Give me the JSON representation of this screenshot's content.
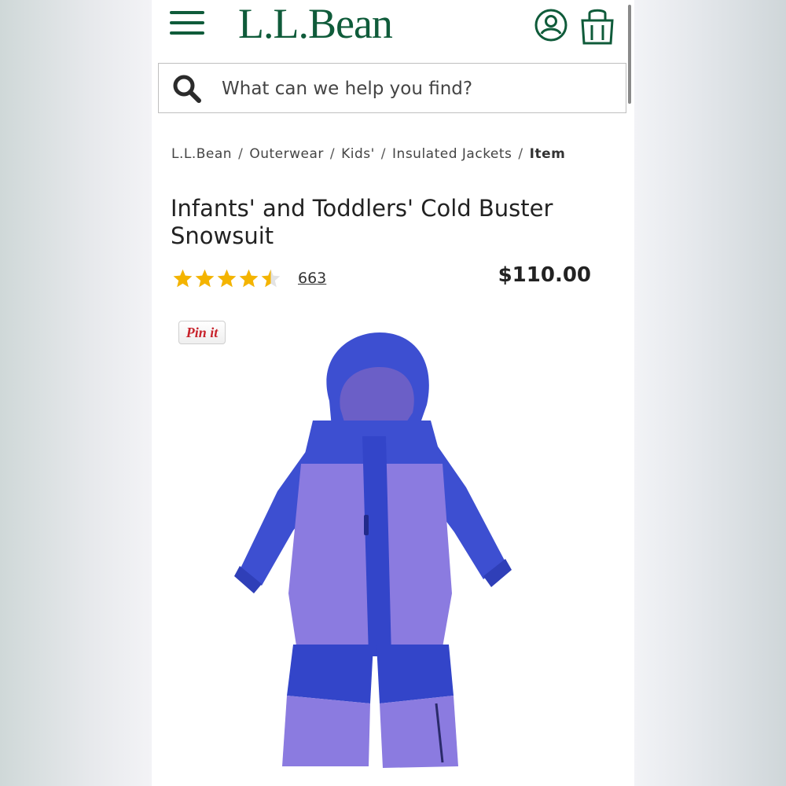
{
  "header": {
    "logo_text": "L.L.Bean",
    "menu_icon": "hamburger-menu-icon",
    "account_icon": "user-account-icon",
    "bag_icon": "shopping-bag-icon"
  },
  "search": {
    "placeholder": "What can we help you find?",
    "icon": "search-icon"
  },
  "breadcrumb": {
    "items": [
      "L.L.Bean",
      "Outerwear",
      "Kids'",
      "Insulated Jackets"
    ],
    "separator": "/",
    "current": "Item"
  },
  "product": {
    "title": "Infants' and Toddlers' Cold Buster Snowsuit",
    "rating": 4.5,
    "review_count": "663",
    "price": "$110.00",
    "pin_label": "Pin it"
  },
  "colors": {
    "brand_green": "#0f5b3a",
    "star_gold": "#f4b400",
    "pinterest_red": "#c8232c"
  }
}
